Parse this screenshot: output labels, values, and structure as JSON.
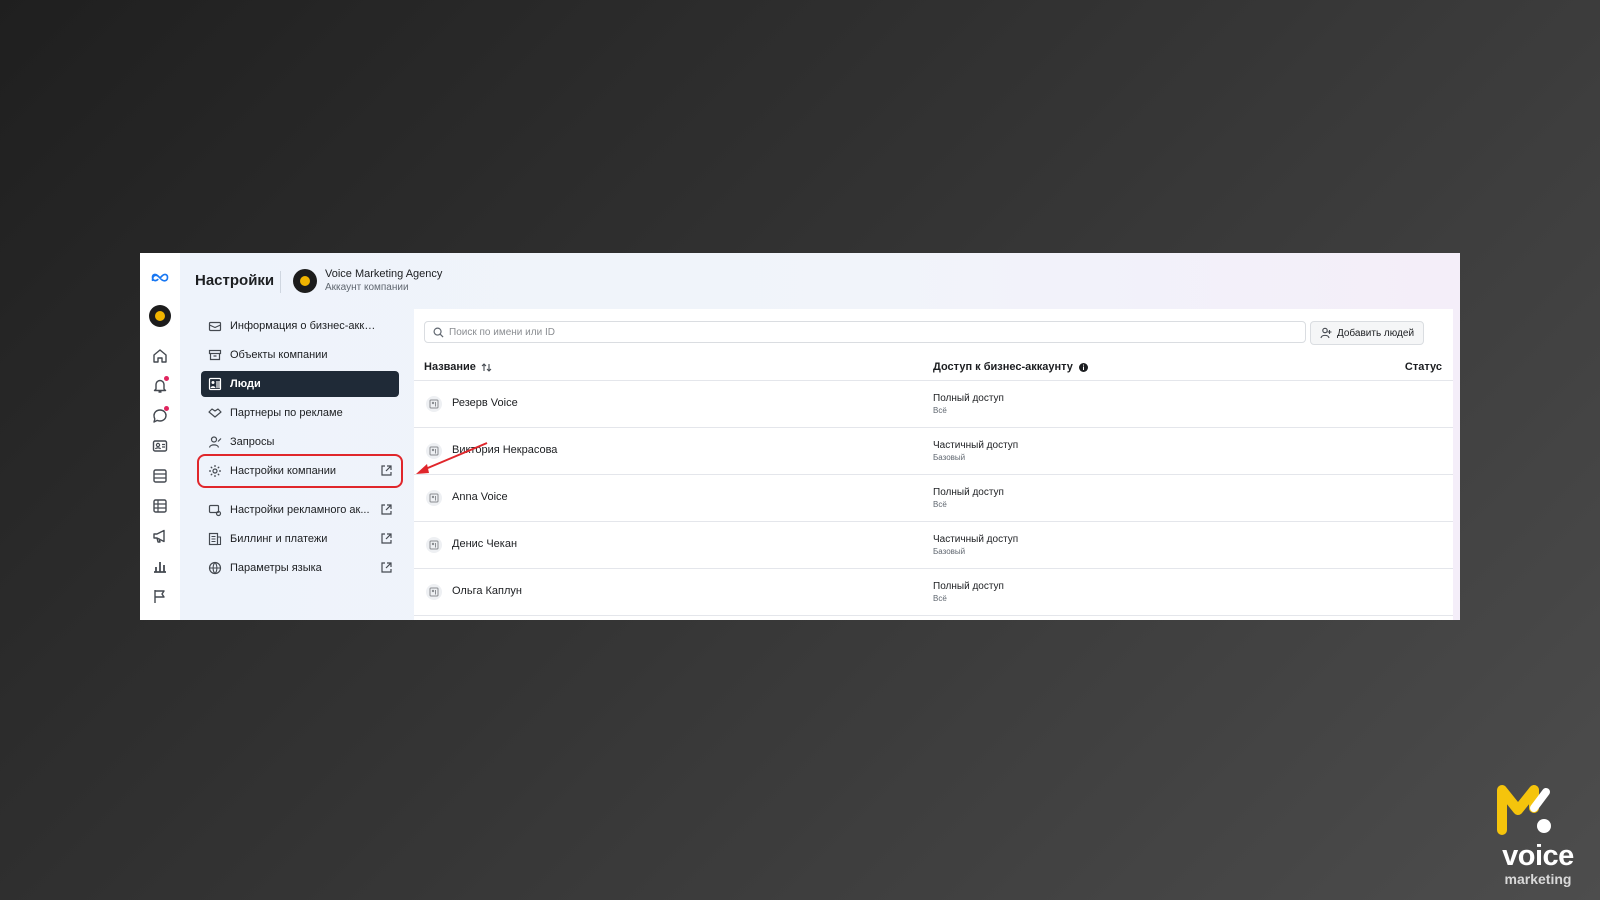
{
  "header": {
    "title": "Настройки",
    "company_name": "Voice Marketing Agency",
    "company_type": "Аккаунт компании"
  },
  "rail": {
    "icons": [
      "meta-logo-icon",
      "company-avatar-icon",
      "home-icon",
      "notifications-icon",
      "chat-icon",
      "contacts-icon",
      "pages-icon",
      "table-icon",
      "megaphone-icon",
      "chart-icon",
      "flag-icon"
    ]
  },
  "menu": {
    "items": [
      {
        "label": "Информация о бизнес-аккау...",
        "icon": "briefcase-icon",
        "external": false
      },
      {
        "label": "Объекты компании",
        "icon": "archive-icon",
        "external": false
      },
      {
        "label": "Люди",
        "icon": "people-icon",
        "external": false,
        "active": true
      },
      {
        "label": "Партнеры по рекламе",
        "icon": "handshake-icon",
        "external": false
      },
      {
        "label": "Запросы",
        "icon": "person-request-icon",
        "external": false
      },
      {
        "label": "Настройки компании",
        "icon": "gear-icon",
        "external": true,
        "highlighted": true
      },
      {
        "label": "Настройки рекламного ак...",
        "icon": "ad-settings-icon",
        "external": true
      },
      {
        "label": "Биллинг и платежи",
        "icon": "billing-icon",
        "external": true
      },
      {
        "label": "Параметры языка",
        "icon": "globe-icon",
        "external": true
      }
    ]
  },
  "people": {
    "search_placeholder": "Поиск по имени или ID",
    "add_button": "Добавить людей",
    "columns": {
      "name": "Название",
      "access": "Доступ к бизнес-аккаунту",
      "status": "Статус"
    },
    "rows": [
      {
        "name": "Резерв Voice",
        "access": "Полный доступ",
        "access_level": "Всё"
      },
      {
        "name": "Виктория Некрасова",
        "access": "Частичный доступ",
        "access_level": "Базовый"
      },
      {
        "name": "Anna Voice",
        "access": "Полный доступ",
        "access_level": "Всё"
      },
      {
        "name": "Денис Чекан",
        "access": "Частичный доступ",
        "access_level": "Базовый"
      },
      {
        "name": "Ольга Каплун",
        "access": "Полный доступ",
        "access_level": "Всё"
      }
    ]
  },
  "brand": {
    "word": "voice",
    "sub": "marketing"
  },
  "colors": {
    "accent": "#1f2a37",
    "highlight": "#e0262b",
    "brand_yellow": "#f5c40c"
  }
}
